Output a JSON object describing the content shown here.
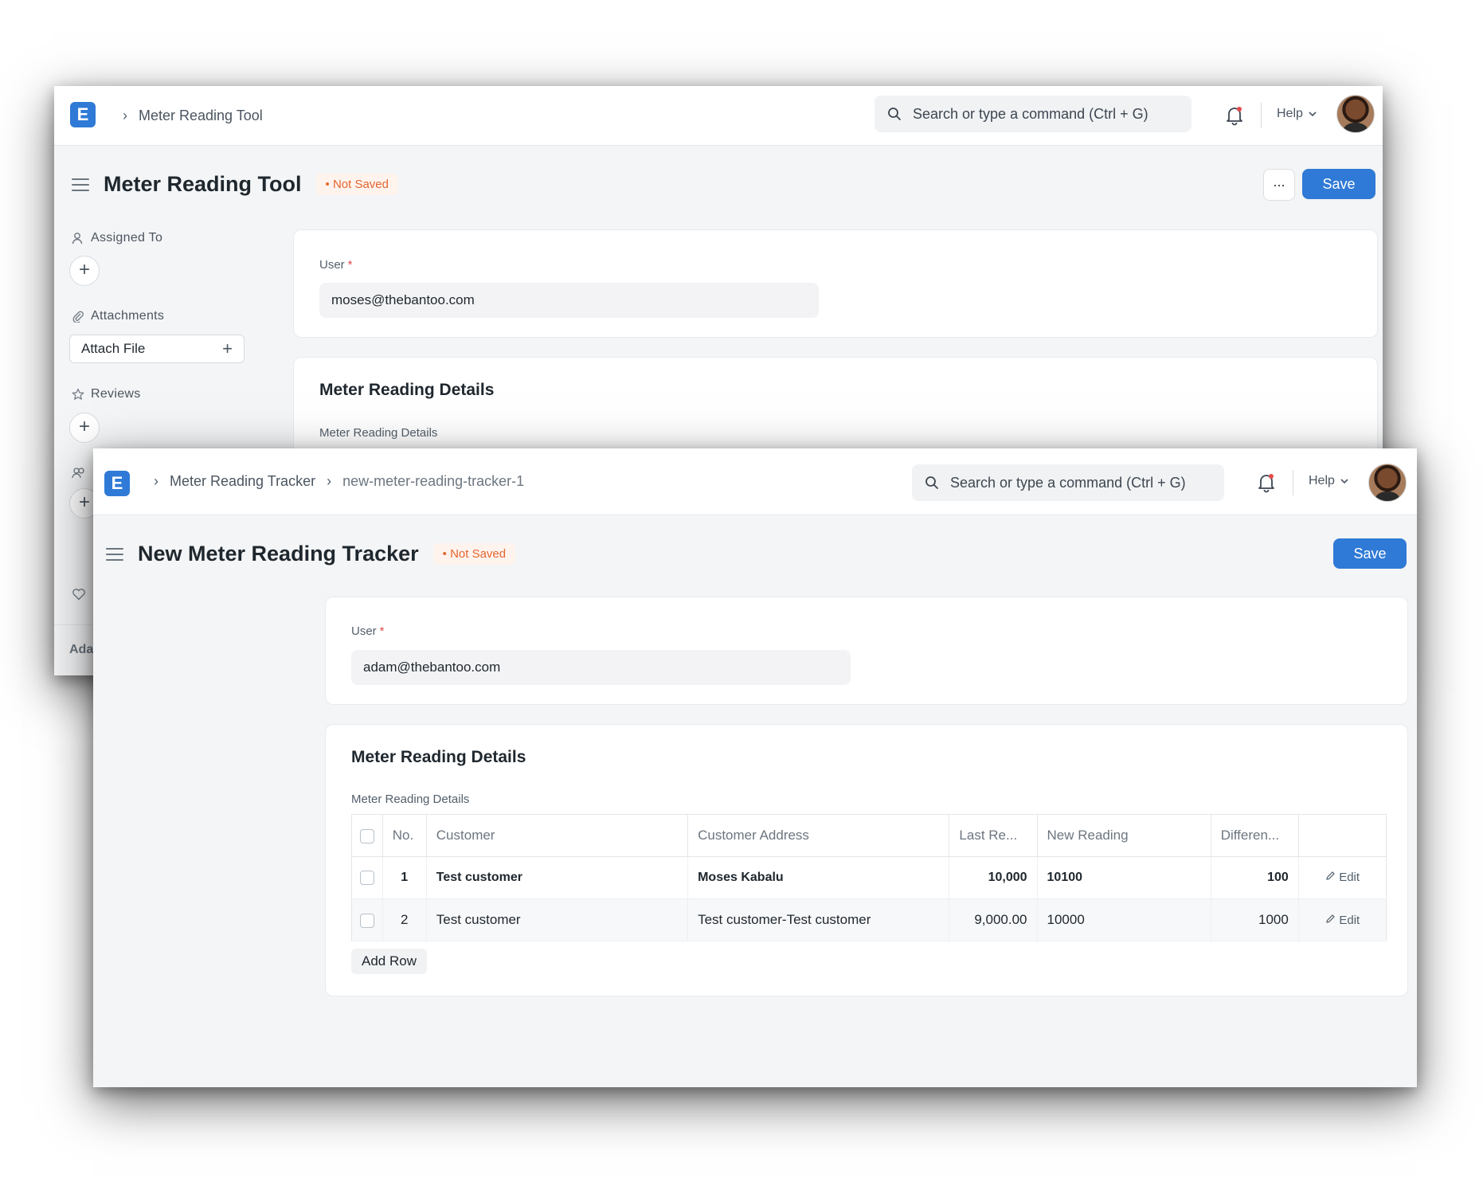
{
  "back_window": {
    "breadcrumb": [
      "Meter Reading Tool"
    ],
    "search_placeholder": "Search or type a command (Ctrl + G)",
    "help_label": "Help",
    "page_title": "Meter Reading Tool",
    "status_badge": "Not Saved",
    "more_label": "...",
    "save_label": "Save",
    "sidebar": {
      "assigned_to": "Assigned To",
      "attachments": "Attachments",
      "attach_file": "Attach File",
      "reviews": "Reviews",
      "cut_text": "Ada"
    },
    "user_label": "User",
    "user_value": "moses@thebantoo.com",
    "section_title": "Meter Reading Details",
    "section_sub": "Meter Reading Details"
  },
  "front_window": {
    "breadcrumb": [
      "Meter Reading Tracker",
      "new-meter-reading-tracker-1"
    ],
    "search_placeholder": "Search or type a command (Ctrl + G)",
    "help_label": "Help",
    "page_title": "New Meter Reading Tracker",
    "status_badge": "Not Saved",
    "save_label": "Save",
    "user_label": "User",
    "user_value": "adam@thebantoo.com",
    "section_title": "Meter Reading Details",
    "section_sub": "Meter Reading Details",
    "table": {
      "columns": [
        "No.",
        "Customer",
        "Customer Address",
        "Last Re...",
        "New Reading",
        "Differen..."
      ],
      "rows": [
        {
          "no": "1",
          "customer": "Test customer",
          "address": "Moses Kabalu",
          "last": "10,000",
          "new": "10100",
          "diff": "100",
          "edit": "Edit"
        },
        {
          "no": "2",
          "customer": "Test customer",
          "address": "Test customer-Test customer",
          "last": "9,000.00",
          "new": "10000",
          "diff": "1000",
          "edit": "Edit"
        }
      ]
    },
    "add_row": "Add Row"
  },
  "icons": [
    "app-logo-icon",
    "chevron-right-icon",
    "search-icon",
    "bell-icon",
    "chevron-down-icon",
    "hamburger-icon",
    "user-assign-icon",
    "paperclip-icon",
    "plus-icon",
    "star-icon",
    "pencil-icon"
  ],
  "colors": {
    "accent": "#2f7ad6",
    "status_orange": "#e2662f",
    "background": "#f4f5f6"
  }
}
